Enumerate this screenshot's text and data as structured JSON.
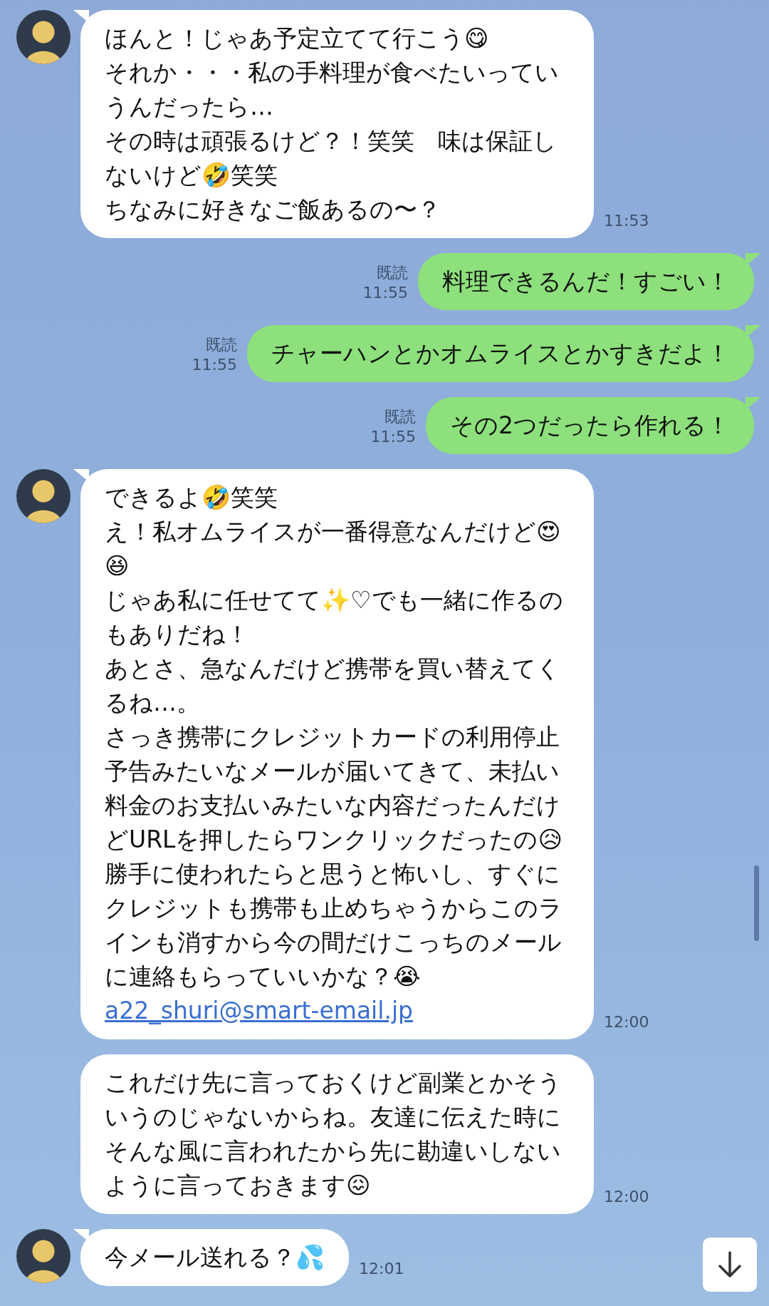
{
  "messages": [
    {
      "kind": "received",
      "avatar": true,
      "paragraphs": [
        "ほんと！じゃあ予定立てて行こう😋",
        "それか・・・私の手料理が食べたいっていうんだったら…",
        "その時は頑張るけど？！笑笑　味は保証しないけど🤣笑笑",
        "ちなみに好きなご飯あるの〜？"
      ],
      "time": "11:53"
    },
    {
      "kind": "sent",
      "read": "既読",
      "paragraphs": [
        "料理できるんだ！すごい！"
      ],
      "time": "11:55"
    },
    {
      "kind": "sent",
      "read": "既読",
      "paragraphs": [
        "チャーハンとかオムライスとかすきだよ！"
      ],
      "time": "11:55"
    },
    {
      "kind": "sent",
      "read": "既読",
      "paragraphs": [
        "その2つだったら作れる！"
      ],
      "time": "11:55"
    },
    {
      "kind": "received",
      "avatar": true,
      "paragraphs": [
        "できるよ🤣笑笑",
        "え！私オムライスが一番得意なんだけど😍😆",
        "じゃあ私に任せてて✨♡でも一緒に作るのもありだね！",
        "あとさ、急なんだけど携帯を買い替えてくるね…。",
        "さっき携帯にクレジットカードの利用停止予告みたいなメールが届いてきて、未払い料金のお支払いみたいな内容だったんだけどURLを押したらワンクリックだったの😥",
        "勝手に使われたらと思うと怖いし、すぐにクレジットも携帯も止めちゃうからこのラインも消すから今の間だけこっちのメールに連絡もらっていいかな？😭"
      ],
      "link": "a22_shuri@smart-email.jp",
      "time": "12:00"
    },
    {
      "kind": "received",
      "avatar": false,
      "paragraphs": [
        "これだけ先に言っておくけど副業とかそういうのじゃないからね。友達に伝えた時にそんな風に言われたから先に勘違いしないように言っておきます😖"
      ],
      "time": "12:00"
    },
    {
      "kind": "received",
      "avatar": true,
      "paragraphs": [
        "今メール送れる？💦"
      ],
      "time": "12:01"
    }
  ]
}
